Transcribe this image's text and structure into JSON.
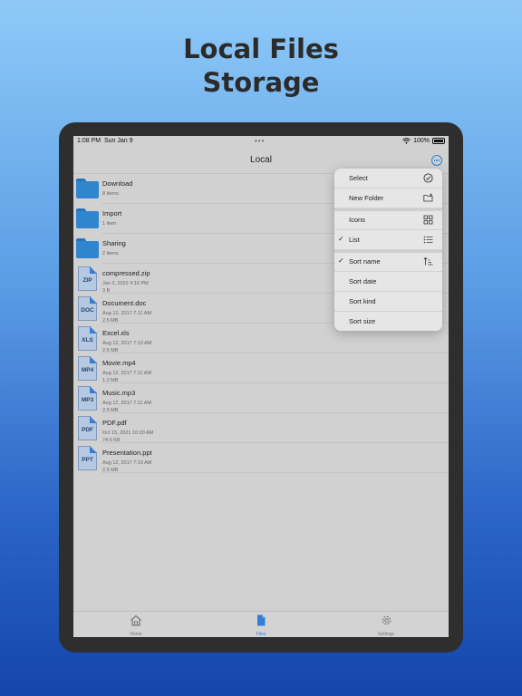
{
  "headline": {
    "line1": "Local Files",
    "line2": "Storage"
  },
  "status": {
    "time": "1:08 PM",
    "date": "Sun Jan 9",
    "battery": "100%"
  },
  "nav": {
    "title": "Local"
  },
  "files": [
    {
      "name": "Download",
      "meta1": "8 items",
      "meta2": "",
      "type": "folder",
      "ext": ""
    },
    {
      "name": "Import",
      "meta1": "1 item",
      "meta2": "",
      "type": "folder",
      "ext": ""
    },
    {
      "name": "Sharing",
      "meta1": "2 items",
      "meta2": "",
      "type": "folder",
      "ext": ""
    },
    {
      "name": "compressed.zip",
      "meta1": "Jan 3, 2022 4:16 PM",
      "meta2": "3 B",
      "type": "doc",
      "ext": "ZIP"
    },
    {
      "name": "Document.doc",
      "meta1": "Aug 12, 2017 7:11 AM",
      "meta2": "2.5 MB",
      "type": "doc",
      "ext": "DOC"
    },
    {
      "name": "Excel.xls",
      "meta1": "Aug 12, 2017 7:10 AM",
      "meta2": "2.5 MB",
      "type": "doc",
      "ext": "XLS"
    },
    {
      "name": "Movie.mp4",
      "meta1": "Aug 12, 2017 7:11 AM",
      "meta2": "1.2 MB",
      "type": "doc",
      "ext": "MP4"
    },
    {
      "name": "Music.mp3",
      "meta1": "Aug 12, 2017 7:11 AM",
      "meta2": "2.5 MB",
      "type": "doc",
      "ext": "MP3"
    },
    {
      "name": "PDF.pdf",
      "meta1": "Oct 15, 2021 10:20 AM",
      "meta2": "74.6 KB",
      "type": "doc",
      "ext": "PDF"
    },
    {
      "name": "Presentation.ppt",
      "meta1": "Aug 12, 2017 7:10 AM",
      "meta2": "2.5 MB",
      "type": "doc",
      "ext": "PPT"
    }
  ],
  "menu": {
    "select": "Select",
    "new_folder": "New Folder",
    "icons": "Icons",
    "list": "List",
    "sort_name": "Sort name",
    "sort_date": "Sort date",
    "sort_kind": "Sort kind",
    "sort_size": "Sort size",
    "check": "✓"
  },
  "tabs": {
    "home": "Home",
    "files": "Files",
    "settings": "Settings"
  },
  "colors": {
    "accent": "#2f7fd6",
    "folder": "#2f86cf",
    "doc_fill": "#b6c9e3"
  }
}
